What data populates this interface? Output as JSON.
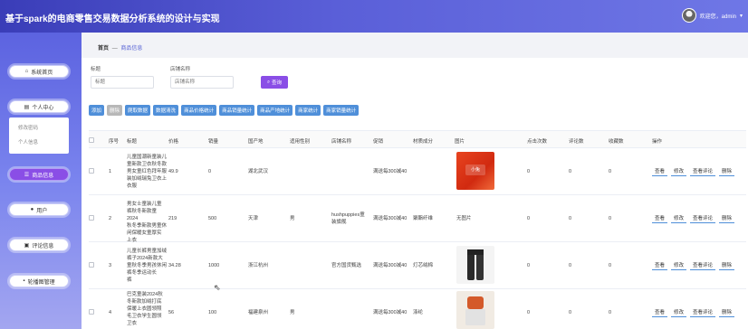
{
  "app": {
    "title": "基于spark的电商零售交易数据分析系统的设计与实现"
  },
  "user": {
    "greeting": "欢迎您，admin"
  },
  "sidebar": {
    "items": [
      {
        "label": "系统首页",
        "icon": "home-icon"
      },
      {
        "label": "个人中心",
        "icon": "user-card-icon"
      },
      {
        "label": "商品信息",
        "icon": "list-icon",
        "active": true
      },
      {
        "label": "用户",
        "icon": "person-icon"
      },
      {
        "label": "评论信息",
        "icon": "lock-icon"
      },
      {
        "label": "轮播图管理",
        "icon": "settings-icon"
      }
    ],
    "submenu": [
      "修改密码",
      "个人信息"
    ]
  },
  "breadcrumb": {
    "home": "首页",
    "sep": "—",
    "current": "商品信息"
  },
  "search": {
    "title_label": "标题",
    "title_placeholder": "标题",
    "shop_label": "店铺名称",
    "shop_placeholder": "店铺名称",
    "query_label": "查询"
  },
  "toolbar": {
    "buttons": [
      "添加",
      "删除",
      "爬取数据",
      "数据清洗",
      "商品价格统计",
      "商品销量统计",
      "商品产地统计",
      "商家统计",
      "商家销量统计"
    ]
  },
  "table": {
    "headers": [
      "序号",
      "标题",
      "价格",
      "销量",
      "国产地",
      "适用性别",
      "店铺名称",
      "促销",
      "材质成分",
      "图片",
      "点击次数",
      "评论数",
      "收藏数",
      "操作"
    ],
    "rows": [
      {
        "index": "1",
        "title": "儿童国潮新童装儿童新款卫衣秋冬款男女童红色拜年服装加绒瑞兔卫衣上衣",
        "title_lines": [
          "儿童国潮新童装儿",
          "童新款卫衣秋冬款",
          "男女童红色拜年服",
          "装加绒瑞兔卫衣上",
          "衣服"
        ],
        "price": "49.9",
        "sales": "0",
        "origin": "湖北武汉",
        "gender": "",
        "shop": "",
        "promo": "满送每300减40",
        "material": "",
        "image": "红色卫衣",
        "clicks": "0",
        "comments": "0",
        "favorites": "0"
      },
      {
        "index": "2",
        "title": "",
        "title_lines": [
          "男女士童装儿童",
          "裤秋冬新款童2024",
          "秋冬季新款男童休",
          "闲保暖女童厚实",
          "上衣"
        ],
        "price": "219",
        "sales": "500",
        "origin": "天津",
        "gender": "男",
        "shop": "hushpuppies童装旗舰店",
        "shop_lines": [
          "hushpuppies童",
          "装旗舰"
        ],
        "promo": "满送每300减40",
        "material": "聚酯纤维",
        "image": "无图片",
        "clicks": "0",
        "comments": "0",
        "favorites": "0"
      },
      {
        "index": "3",
        "title": "",
        "title_lines": [
          "儿童长裤男童加绒",
          "裤子2024新款大",
          "童秋冬季男孩休闲",
          "裤冬季运动长",
          "裤"
        ],
        "price": "34.28",
        "sales": "1000",
        "origin": "浙江杭州",
        "gender": "",
        "shop": "官方国货甄选",
        "promo": "满送每300减40",
        "material": "灯芯绒棉",
        "image": "运动长裤",
        "clicks": "0",
        "comments": "0",
        "favorites": "0"
      },
      {
        "index": "4",
        "title": "",
        "title_lines": [
          "巴克童装2024秋",
          "冬新款加绒打底",
          "保暖上衣圆领照",
          "毛卫衣学生圆领",
          "卫衣"
        ],
        "price": "56",
        "sales": "100",
        "origin": "福建泉州",
        "gender": "男",
        "shop": "",
        "promo": "满送每300减40",
        "material": "涤纶",
        "image": "卫衣",
        "clicks": "0",
        "comments": "0",
        "favorites": "0"
      }
    ],
    "actions": [
      "查看",
      "修改",
      "查看评论",
      "删除"
    ]
  }
}
